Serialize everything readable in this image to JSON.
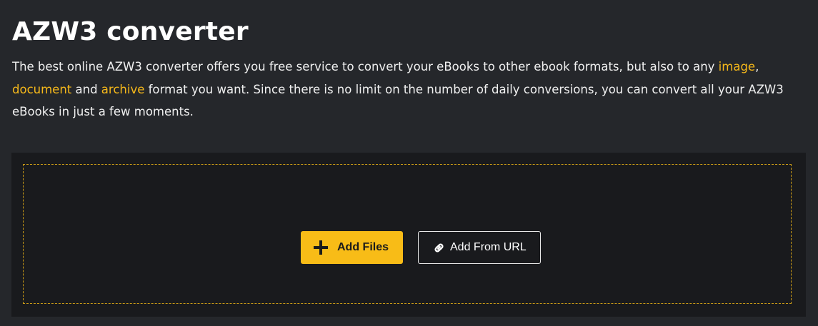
{
  "header": {
    "title": "AZW3 converter",
    "intro": {
      "part1": "The best online AZW3 converter offers you free service to convert your eBooks to other ebook formats, but also to any ",
      "link_image": "image",
      "part2": ",",
      "link_document": "document",
      "part3": " and ",
      "link_archive": "archive",
      "part4": " format you want. Since there is no limit on the number of daily conversions, you can convert all your AZW3 eBooks in just a few moments."
    }
  },
  "uploader": {
    "add_files_label": "Add Files",
    "add_files_icon": "plus-icon",
    "add_url_label": "Add From URL",
    "add_url_icon": "link-icon"
  },
  "colors": {
    "background": "#25272b",
    "panel": "#191a1d",
    "accent": "#f8bc17",
    "dashed_border": "#c99a16",
    "text": "#ffffff"
  }
}
